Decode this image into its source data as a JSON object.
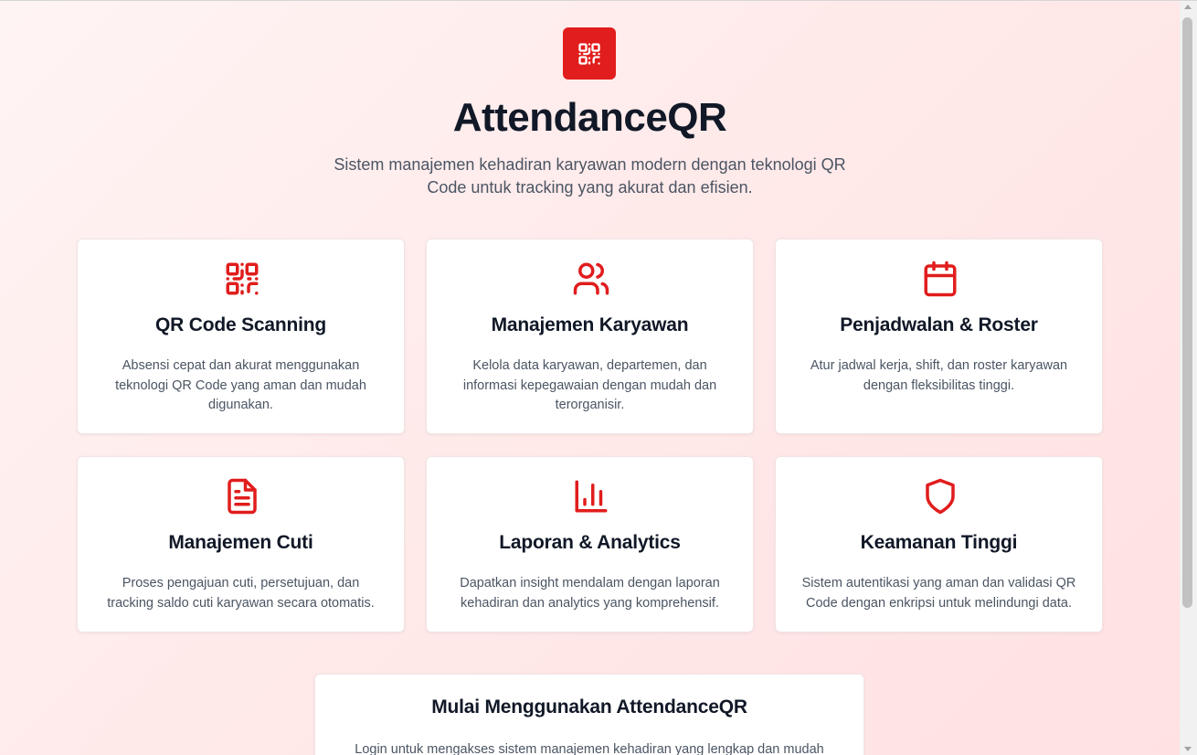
{
  "brand": {
    "title": "AttendanceQR",
    "subtitle": "Sistem manajemen kehadiran karyawan modern dengan teknologi QR Code untuk tracking yang akurat dan efisien.",
    "logo_icon": "qr-code-icon",
    "accent_color": "#e11d1d"
  },
  "features": [
    {
      "icon": "qr-code-icon",
      "title": "QR Code Scanning",
      "description": "Absensi cepat dan akurat menggunakan teknologi QR Code yang aman dan mudah digunakan."
    },
    {
      "icon": "users-icon",
      "title": "Manajemen Karyawan",
      "description": "Kelola data karyawan, departemen, dan informasi kepegawaian dengan mudah dan terorganisir."
    },
    {
      "icon": "calendar-icon",
      "title": "Penjadwalan & Roster",
      "description": "Atur jadwal kerja, shift, dan roster karyawan dengan fleksibilitas tinggi."
    },
    {
      "icon": "file-text-icon",
      "title": "Manajemen Cuti",
      "description": "Proses pengajuan cuti, persetujuan, dan tracking saldo cuti karyawan secara otomatis."
    },
    {
      "icon": "bar-chart-icon",
      "title": "Laporan & Analytics",
      "description": "Dapatkan insight mendalam dengan laporan kehadiran dan analytics yang komprehensif."
    },
    {
      "icon": "shield-icon",
      "title": "Keamanan Tinggi",
      "description": "Sistem autentikasi yang aman dan validasi QR Code dengan enkripsi untuk melindungi data."
    }
  ],
  "cta": {
    "title": "Mulai Menggunakan AttendanceQR",
    "description": "Login untuk mengakses sistem manajemen kehadiran yang lengkap dan mudah"
  }
}
